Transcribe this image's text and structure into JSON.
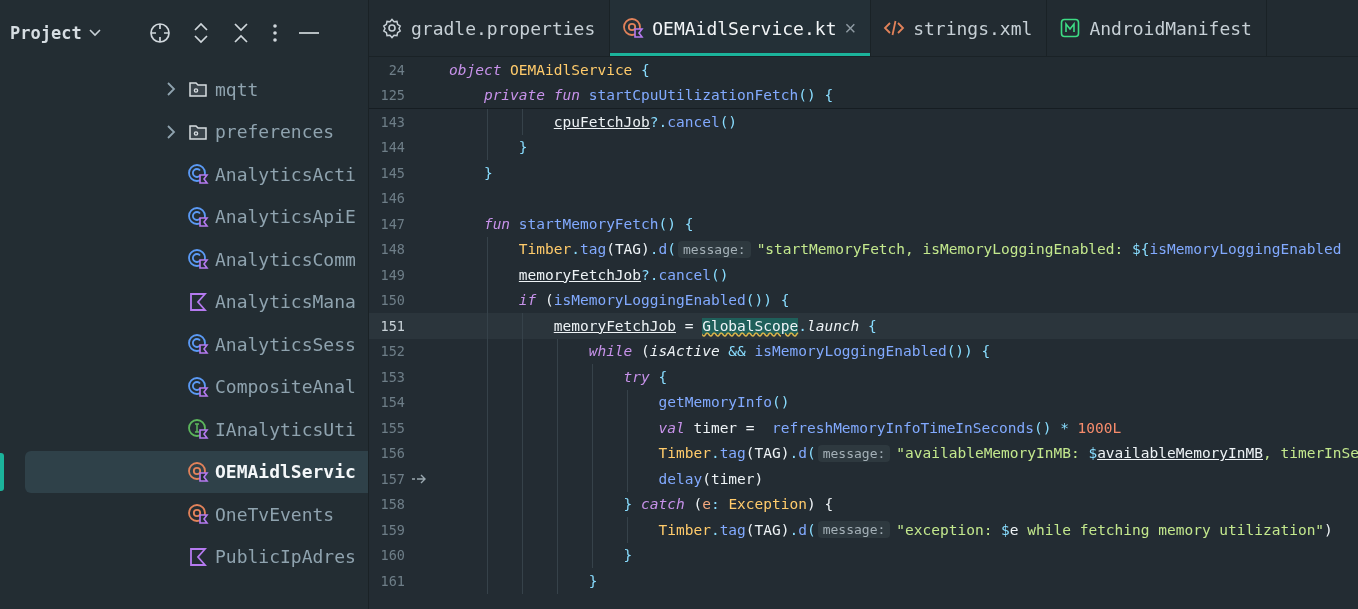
{
  "project_panel": {
    "title": "Project",
    "items": [
      {
        "label": "mqtt",
        "kind": "folder",
        "selected": false
      },
      {
        "label": "preferences",
        "kind": "folder",
        "selected": false
      },
      {
        "label": "AnalyticsActi",
        "kind": "class",
        "selected": false
      },
      {
        "label": "AnalyticsApiE",
        "kind": "class",
        "selected": false
      },
      {
        "label": "AnalyticsComm",
        "kind": "class",
        "selected": false
      },
      {
        "label": "AnalyticsMana",
        "kind": "file",
        "selected": false
      },
      {
        "label": "AnalyticsSess",
        "kind": "class",
        "selected": false
      },
      {
        "label": "CompositeAnal",
        "kind": "class",
        "selected": false
      },
      {
        "label": "IAnalyticsUti",
        "kind": "interface",
        "selected": false
      },
      {
        "label": "OEMAidlServic",
        "kind": "object",
        "selected": true
      },
      {
        "label": "OneTvEvents",
        "kind": "object",
        "selected": false
      },
      {
        "label": "PublicIpAdres",
        "kind": "file",
        "selected": false
      }
    ]
  },
  "tabs": [
    {
      "label": "gradle.properties",
      "kind": "settings",
      "selected": false,
      "closable": false
    },
    {
      "label": "OEMAidlService.kt",
      "kind": "object",
      "selected": true,
      "closable": true,
      "close": "×"
    },
    {
      "label": "strings.xml",
      "kind": "xml",
      "selected": false,
      "closable": false
    },
    {
      "label": "AndroidManifest",
      "kind": "manifest",
      "selected": false,
      "closable": false
    }
  ],
  "editor": {
    "sticky_lines": [
      {
        "number": "24",
        "tokens": [
          {
            "text": "object",
            "kind": "keyword"
          },
          {
            "text": " OEMAidlService",
            "kind": "type"
          },
          {
            "text": " {",
            "kind": "punct"
          }
        ]
      },
      {
        "number": "125",
        "tokens": [
          {
            "text": "    private fun",
            "kind": "keyword"
          },
          {
            "text": " startCpuUtilizationFetch",
            "kind": "function"
          },
          {
            "text": "() {",
            "kind": "punct"
          }
        ]
      }
    ],
    "lines": [
      {
        "number": "143",
        "current": false,
        "marker": false,
        "tokens": [
          {
            "text": "            cpuFetchJob",
            "kind": "property"
          },
          {
            "text": "?.",
            "kind": "punct"
          },
          {
            "text": "cancel",
            "kind": "function"
          },
          {
            "text": "()",
            "kind": "punct"
          }
        ]
      },
      {
        "number": "144",
        "current": false,
        "marker": false,
        "tokens": [
          {
            "text": "        }",
            "kind": "punct"
          }
        ]
      },
      {
        "number": "145",
        "current": false,
        "marker": false,
        "tokens": [
          {
            "text": "    }",
            "kind": "punct"
          }
        ]
      },
      {
        "number": "146",
        "current": false,
        "marker": false
      },
      {
        "number": "147",
        "current": false,
        "marker": false,
        "tokens": [
          {
            "text": "    fun",
            "kind": "keyword"
          },
          {
            "text": " startMemoryFetch",
            "kind": "function"
          },
          {
            "text": "() {",
            "kind": "punct"
          }
        ]
      },
      {
        "number": "148",
        "current": false,
        "marker": false,
        "tokens": [
          {
            "text": "        Timber",
            "kind": "type"
          },
          {
            "text": ".",
            "kind": "punct"
          },
          {
            "text": "tag",
            "kind": "function"
          },
          {
            "text": "(TAG)",
            "kind": "plain"
          },
          {
            "text": ".",
            "kind": "punct"
          },
          {
            "text": "d",
            "kind": "function"
          },
          {
            "text": "(",
            "kind": "punct"
          },
          {
            "text": "message:",
            "kind": "hint"
          },
          {
            "text": "\"startMemoryFetch, isMemoryLoggingEnabled: ",
            "kind": "string"
          },
          {
            "text": "${",
            "kind": "punct"
          },
          {
            "text": "isMemoryLoggingEnabled",
            "kind": "function"
          }
        ]
      },
      {
        "number": "149",
        "current": false,
        "marker": false,
        "tokens": [
          {
            "text": "        memoryFetchJob",
            "kind": "property"
          },
          {
            "text": "?.",
            "kind": "punct"
          },
          {
            "text": "cancel",
            "kind": "function"
          },
          {
            "text": "()",
            "kind": "punct"
          }
        ]
      },
      {
        "number": "150",
        "current": false,
        "marker": false,
        "tokens": [
          {
            "text": "        if",
            "kind": "keyword"
          },
          {
            "text": " (",
            "kind": "plain"
          },
          {
            "text": "isMemoryLoggingEnabled",
            "kind": "function"
          },
          {
            "text": "()) {",
            "kind": "punct"
          }
        ]
      },
      {
        "number": "151",
        "current": true,
        "marker": false,
        "tokens": [
          {
            "text": "            memoryFetchJob",
            "kind": "property"
          },
          {
            "text": " = ",
            "kind": "plain"
          },
          {
            "text": "GlobalScope",
            "kind": "warning"
          },
          {
            "text": ".",
            "kind": "punct"
          },
          {
            "text": "launch",
            "kind": "extension"
          },
          {
            "text": " {",
            "kind": "punct"
          }
        ]
      },
      {
        "number": "152",
        "current": false,
        "marker": false,
        "tokens": [
          {
            "text": "                while",
            "kind": "keyword"
          },
          {
            "text": " (",
            "kind": "plain"
          },
          {
            "text": "isActive",
            "kind": "extension"
          },
          {
            "text": " && ",
            "kind": "punct"
          },
          {
            "text": "isMemoryLoggingEnabled",
            "kind": "function"
          },
          {
            "text": "()) {",
            "kind": "punct"
          }
        ]
      },
      {
        "number": "153",
        "current": false,
        "marker": false,
        "tokens": [
          {
            "text": "                    try",
            "kind": "keyword"
          },
          {
            "text": " {",
            "kind": "punct"
          }
        ]
      },
      {
        "number": "154",
        "current": false,
        "marker": false,
        "tokens": [
          {
            "text": "                        getMemoryInfo",
            "kind": "function"
          },
          {
            "text": "()",
            "kind": "punct"
          }
        ]
      },
      {
        "number": "155",
        "current": false,
        "marker": false,
        "tokens": [
          {
            "text": "                        val",
            "kind": "keyword"
          },
          {
            "text": " timer =  ",
            "kind": "plain"
          },
          {
            "text": "refreshMemoryInfoTimeInSeconds",
            "kind": "function"
          },
          {
            "text": "() * ",
            "kind": "punct"
          },
          {
            "text": "1000L",
            "kind": "number"
          }
        ]
      },
      {
        "number": "156",
        "current": false,
        "marker": false,
        "tokens": [
          {
            "text": "                        Timber",
            "kind": "type"
          },
          {
            "text": ".",
            "kind": "punct"
          },
          {
            "text": "tag",
            "kind": "function"
          },
          {
            "text": "(TAG)",
            "kind": "plain"
          },
          {
            "text": ".",
            "kind": "punct"
          },
          {
            "text": "d",
            "kind": "function"
          },
          {
            "text": "(",
            "kind": "punct"
          },
          {
            "text": "message:",
            "kind": "hint"
          },
          {
            "text": "\"availableMemoryInMB: ",
            "kind": "string"
          },
          {
            "text": "$",
            "kind": "punct"
          },
          {
            "text": "availableMemoryInMB",
            "kind": "property"
          },
          {
            "text": ", timerInSe",
            "kind": "string"
          }
        ]
      },
      {
        "number": "157",
        "current": false,
        "marker": true,
        "tokens": [
          {
            "text": "                        delay",
            "kind": "function"
          },
          {
            "text": "(timer)",
            "kind": "plain"
          }
        ]
      },
      {
        "number": "158",
        "current": false,
        "marker": false,
        "tokens": [
          {
            "text": "                    }",
            "kind": "punct"
          },
          {
            "text": " catch",
            "kind": "keyword"
          },
          {
            "text": " (",
            "kind": "plain"
          },
          {
            "text": "e",
            "kind": "param"
          },
          {
            "text": ": ",
            "kind": "punct"
          },
          {
            "text": "Exception",
            "kind": "type"
          },
          {
            "text": ") {",
            "kind": "plain"
          }
        ]
      },
      {
        "number": "159",
        "current": false,
        "marker": false,
        "tokens": [
          {
            "text": "                        Timber",
            "kind": "type"
          },
          {
            "text": ".",
            "kind": "punct"
          },
          {
            "text": "tag",
            "kind": "function"
          },
          {
            "text": "(TAG)",
            "kind": "plain"
          },
          {
            "text": ".",
            "kind": "punct"
          },
          {
            "text": "d",
            "kind": "function"
          },
          {
            "text": "(",
            "kind": "punct"
          },
          {
            "text": "message:",
            "kind": "hint"
          },
          {
            "text": "\"exception: ",
            "kind": "string"
          },
          {
            "text": "$",
            "kind": "punct"
          },
          {
            "text": "e",
            "kind": "plain"
          },
          {
            "text": " while fetching memory utilization\"",
            "kind": "string"
          },
          {
            "text": ")",
            "kind": "plain"
          }
        ]
      },
      {
        "number": "160",
        "current": false,
        "marker": false,
        "tokens": [
          {
            "text": "                    }",
            "kind": "punct"
          }
        ]
      },
      {
        "number": "161",
        "current": false,
        "marker": false,
        "tokens": [
          {
            "text": "                }",
            "kind": "punct"
          }
        ]
      }
    ]
  }
}
